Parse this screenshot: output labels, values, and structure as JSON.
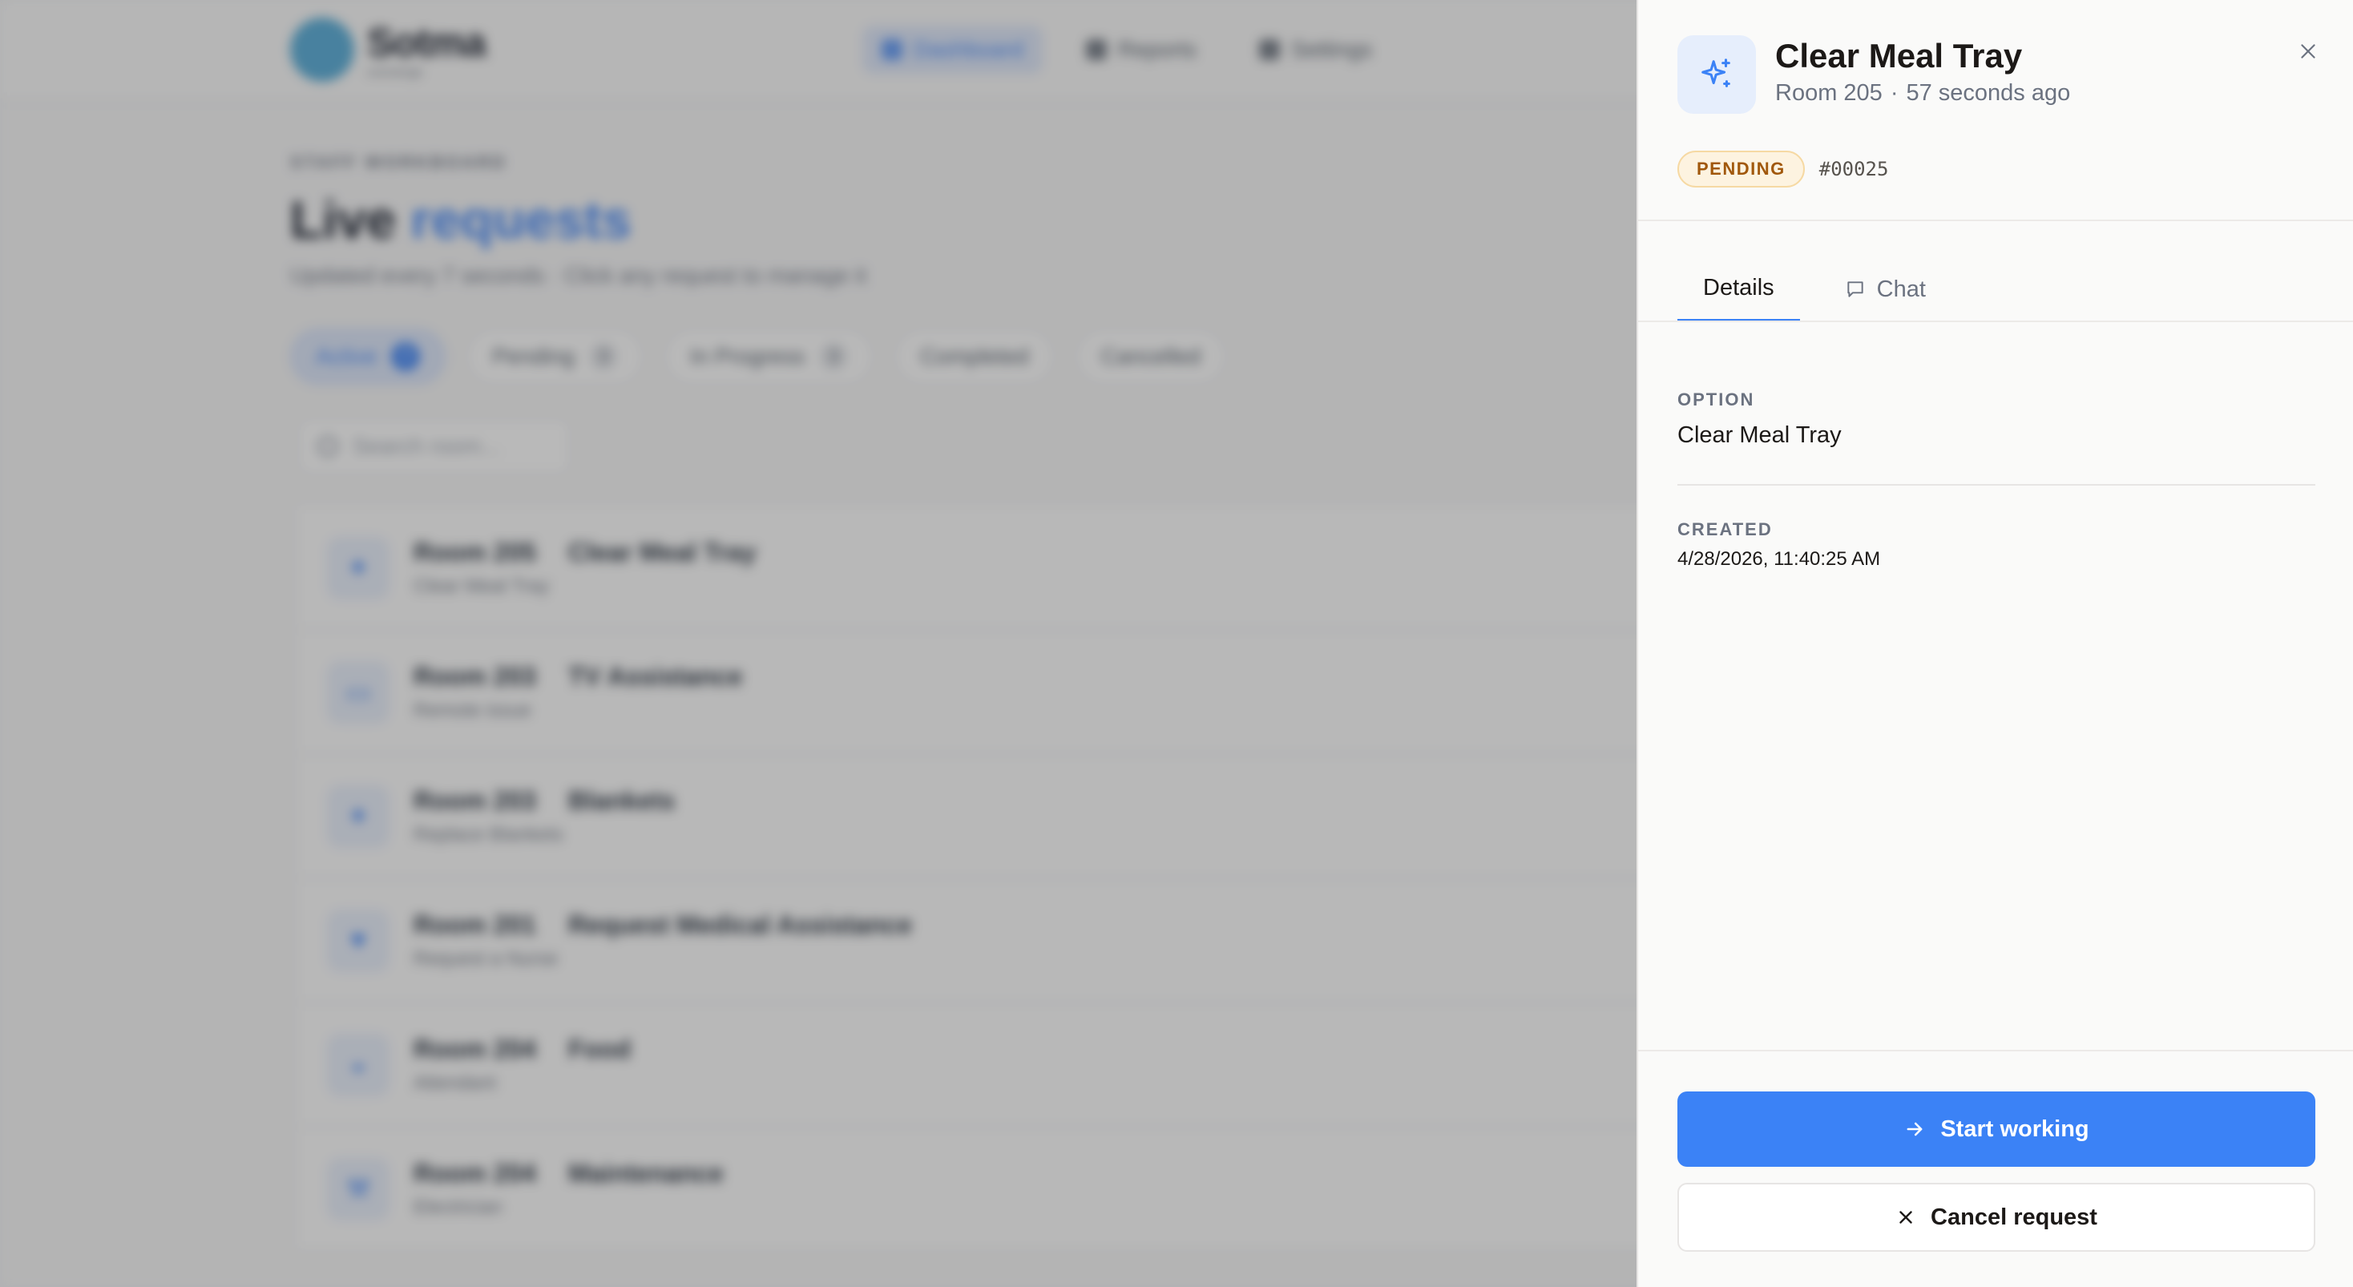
{
  "background": {
    "brand": {
      "name": "Sotma",
      "tagline": "concierge"
    },
    "nav": [
      {
        "label": "Dashboard",
        "active": true
      },
      {
        "label": "Reports",
        "active": false
      },
      {
        "label": "Settings",
        "active": false
      }
    ],
    "eyebrow": "STAFF WORKBOARD",
    "title_plain": "Live",
    "title_accent": "requests",
    "subtitle": "Updated every 7 seconds · Click any request to manage it",
    "filters": [
      {
        "label": "Active",
        "count": "7",
        "active": true
      },
      {
        "label": "Pending",
        "count": "3",
        "active": false
      },
      {
        "label": "In Progress",
        "count": "3",
        "active": false
      },
      {
        "label": "Completed",
        "count": "",
        "active": false
      },
      {
        "label": "Cancelled",
        "count": "",
        "active": false
      }
    ],
    "search_placeholder": "Search room...",
    "requests": [
      {
        "room": "Room 205",
        "title": "Clear Meal Tray",
        "detail": "Clear Meal Tray",
        "icon": "sparkle-icon"
      },
      {
        "room": "Room 203",
        "title": "TV Assistance",
        "detail": "Remote issue",
        "icon": "tv-icon"
      },
      {
        "room": "Room 203",
        "title": "Blankets",
        "detail": "Replace Blankets",
        "icon": "sparkle-icon"
      },
      {
        "room": "Room 201",
        "title": "Request Medical Assistance",
        "detail": "Request a Nurse",
        "icon": "medical-icon"
      },
      {
        "room": "Room 204",
        "title": "Food",
        "detail": "Attendant",
        "icon": "food-icon"
      },
      {
        "room": "Room 204",
        "title": "Maintenance",
        "detail": "Electrician",
        "icon": "wrench-icon"
      }
    ]
  },
  "panel": {
    "title": "Clear Meal Tray",
    "room": "Room 205",
    "separator": "·",
    "time_ago": "57 seconds ago",
    "status": "PENDING",
    "request_id": "#00025",
    "tabs": [
      {
        "label": "Details",
        "active": true
      },
      {
        "label": "Chat",
        "active": false
      }
    ],
    "fields": {
      "option_label": "OPTION",
      "option_value": "Clear Meal Tray",
      "created_label": "CREATED",
      "created_value": "4/28/2026, 11:40:25 AM"
    },
    "actions": {
      "primary": "Start working",
      "secondary": "Cancel request"
    }
  },
  "colors": {
    "accent": "#3b82f6",
    "pending_text": "#a1580c",
    "pending_bg": "#fdf3e0"
  }
}
